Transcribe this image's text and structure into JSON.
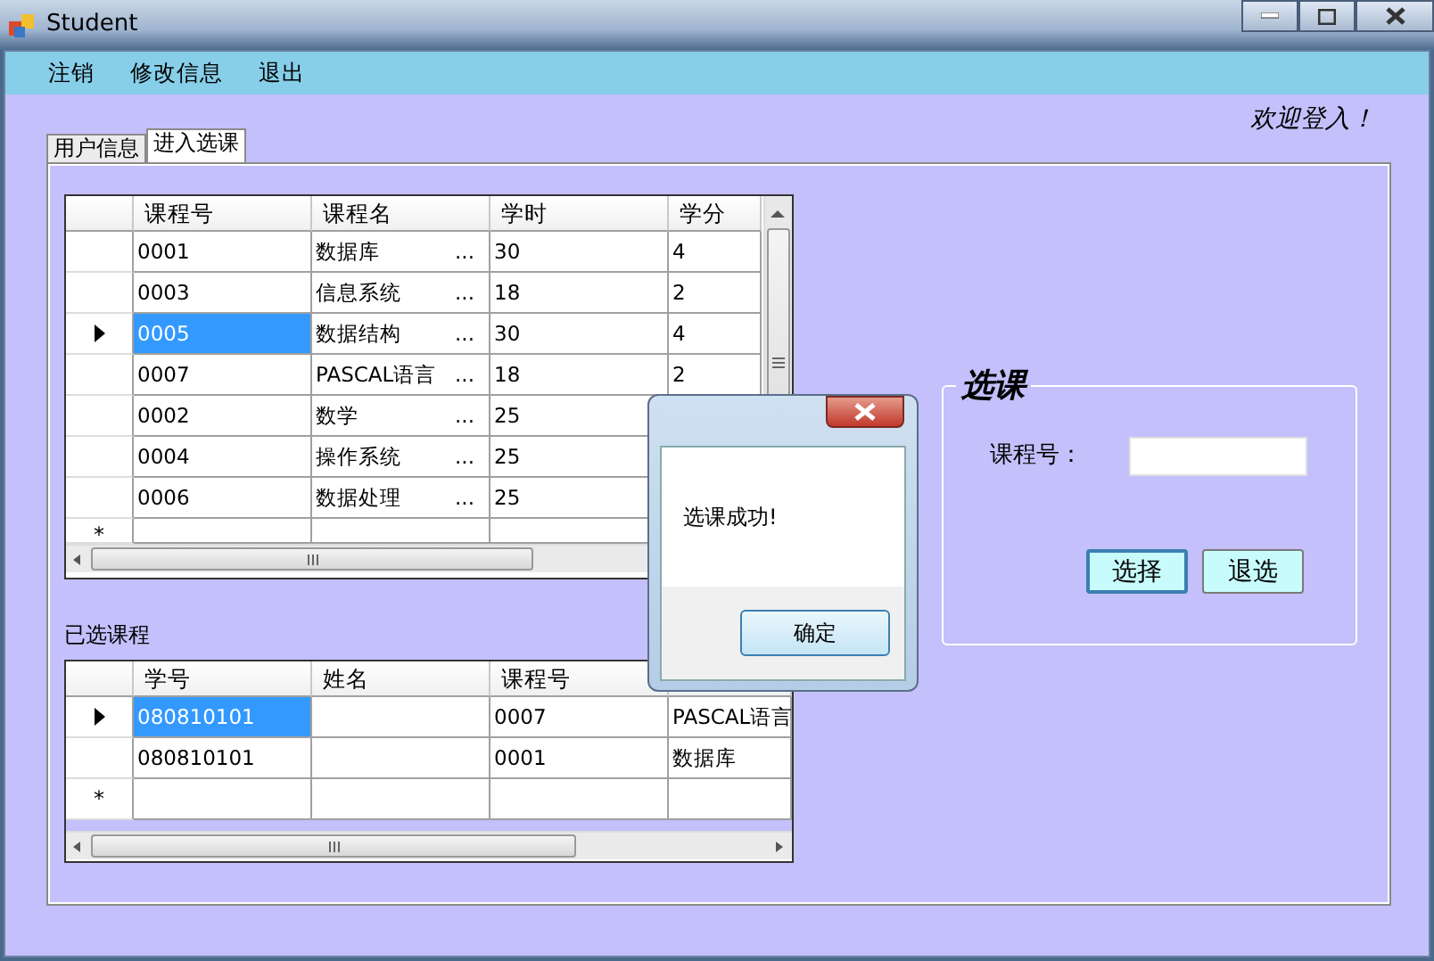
{
  "window": {
    "title": "Student"
  },
  "menu": [
    {
      "label": "注销"
    },
    {
      "label": "修改信息"
    },
    {
      "label": "退出"
    }
  ],
  "welcome": "欢迎登入！",
  "tabs": [
    {
      "label": "用户信息",
      "selected": false
    },
    {
      "label": "进入选课",
      "selected": true
    }
  ],
  "courses": {
    "columns": [
      "课程号",
      "课程名",
      "学时",
      "学分"
    ],
    "new_row_marker": "*",
    "rows": [
      {
        "id": "0001",
        "name": "数据库",
        "more": "...",
        "hours": "30",
        "credit": "4",
        "selected": false
      },
      {
        "id": "0003",
        "name": "信息系统",
        "more": "...",
        "hours": "18",
        "credit": "2",
        "selected": false
      },
      {
        "id": "0005",
        "name": "数据结构",
        "more": "...",
        "hours": "30",
        "credit": "4",
        "selected": true
      },
      {
        "id": "0007",
        "name": "PASCAL语言",
        "more": "...",
        "hours": "18",
        "credit": "2",
        "selected": false
      },
      {
        "id": "0002",
        "name": "数学",
        "more": "...",
        "hours": "25",
        "selected": false
      },
      {
        "id": "0004",
        "name": "操作系统",
        "more": "...",
        "hours": "25",
        "selected": false
      },
      {
        "id": "0006",
        "name": "数据处理",
        "more": "...",
        "hours": "25",
        "selected": false
      }
    ]
  },
  "chosen_label": "已选课程",
  "chosen": {
    "columns": [
      "学号",
      "姓名",
      "课程号"
    ],
    "new_row_marker": "*",
    "rows": [
      {
        "student": "080810101",
        "course": "0007",
        "course_name": "PASCAL语言",
        "selected": true
      },
      {
        "student": "080810101",
        "course": "0001",
        "course_name": "数据库",
        "selected": false
      }
    ]
  },
  "select_group": {
    "title": "选课",
    "field_label": "课程号：",
    "buttons": [
      {
        "label": "选择",
        "focused": true
      },
      {
        "label": "退选",
        "focused": false
      }
    ]
  },
  "dialog": {
    "message": "选课成功!",
    "button": "确定"
  }
}
